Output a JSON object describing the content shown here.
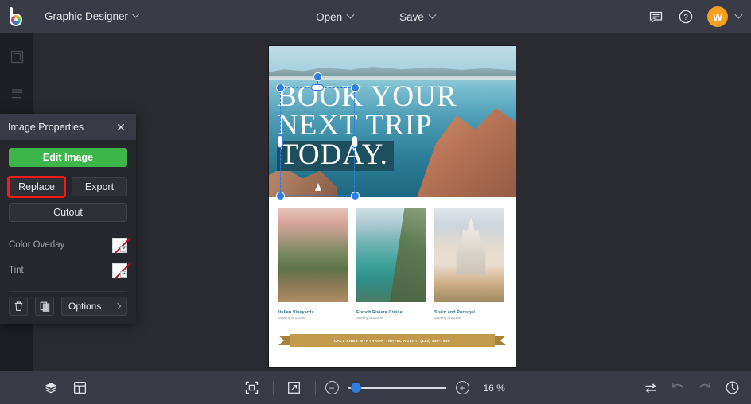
{
  "topbar": {
    "logo_icon": "bewe-color-wheel-logo",
    "document_title": "Graphic Designer",
    "open_label": "Open",
    "save_label": "Save",
    "chat_icon": "chat-bubble-icon",
    "help_icon": "question-mark-circle-icon",
    "avatar_initial": "W"
  },
  "left_rail": {
    "items": [
      {
        "icon": "templates-icon",
        "name": "templates"
      },
      {
        "icon": "text-lines-icon",
        "name": "text"
      },
      {
        "icon": "columns-layout-icon",
        "name": "layouts"
      }
    ]
  },
  "panel": {
    "title": "Image Properties",
    "close_icon": "close-icon",
    "edit_image_label": "Edit Image",
    "replace_label": "Replace",
    "export_label": "Export",
    "cutout_label": "Cutout",
    "color_overlay_label": "Color Overlay",
    "color_overlay_value": "none",
    "tint_label": "Tint",
    "tint_value": "none",
    "delete_icon": "trash-icon",
    "duplicate_icon": "duplicate-icon",
    "options_label": "Options",
    "options_arrow_icon": "chevron-right-icon",
    "highlight_color": "#f51a1a",
    "accent_green": "#3cb54a"
  },
  "canvas": {
    "poster": {
      "headline_line1": "BOOK YOUR",
      "headline_line2": "NEXT TRIP",
      "headline_line3": "TODAY.",
      "headline_highlight_color": "#1d4f5e",
      "cards": [
        {
          "title": "Italian Vineyards",
          "subtitle": "Starting at £1200"
        },
        {
          "title": "French Riviera Cruise",
          "subtitle": "Starting at £1100"
        },
        {
          "title": "Spain and Portugal",
          "subtitle": "Starting at £2100"
        }
      ],
      "ribbon_text": "CALL ANNA WYNTHROP, TRAVEL AGENT: (123) 456-7890",
      "ribbon_color": "#c19a4b"
    },
    "selection": {
      "target": "italian-vineyards-image",
      "handle_color": "#2f7de1"
    }
  },
  "bottombar": {
    "layers_icon": "layers-icon",
    "grid_icon": "page-layout-icon",
    "fit_icon": "fit-to-screen-icon",
    "fullscreen_icon": "expand-arrow-icon",
    "zoom_out_icon": "minus-icon",
    "zoom_in_icon": "plus-icon",
    "zoom_value": "16 %",
    "swap_icon": "swap-arrows-icon",
    "undo_icon": "undo-arrow-icon",
    "redo_icon": "redo-arrow-icon",
    "history_icon": "clock-history-icon"
  }
}
